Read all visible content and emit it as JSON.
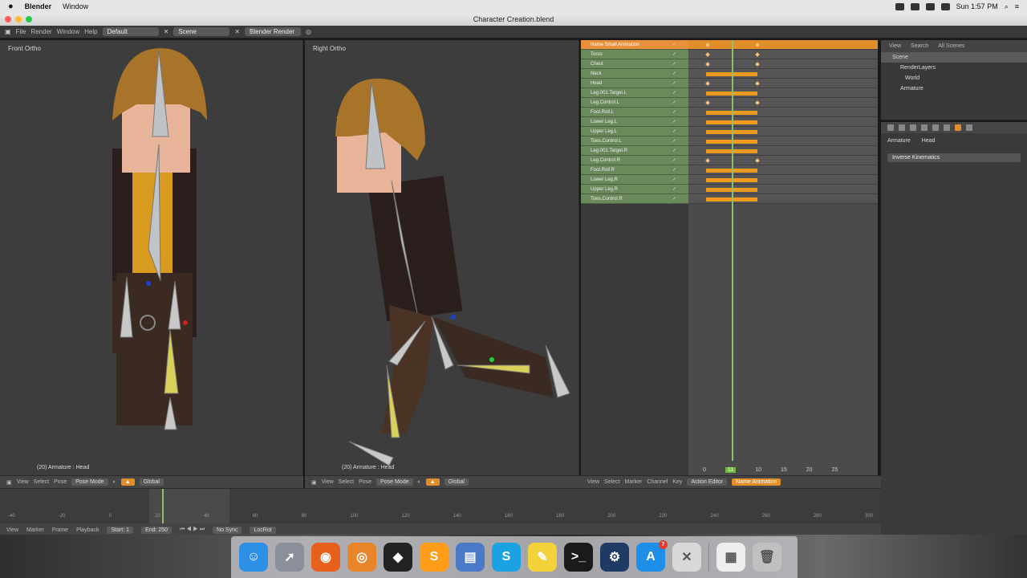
{
  "menubar": {
    "app": "Blender",
    "menu": "Window",
    "clock": "Sun 1:57 PM"
  },
  "window": {
    "title": "Character Creation.blend"
  },
  "info_header": {
    "menus": [
      "File",
      "Render",
      "Window",
      "Help"
    ],
    "layout": "Default",
    "scene": "Scene",
    "engine": "Blender Render"
  },
  "viewports": [
    {
      "label": "Front Ortho",
      "footer": "(20) Armature : Head"
    },
    {
      "label": "Right Ortho",
      "footer": "(20) Armature : Head"
    }
  ],
  "viewport_header": {
    "items": [
      "View",
      "Select",
      "Pose",
      "Pose Mode",
      "Global"
    ],
    "items_right": [
      "View",
      "Select",
      "Pose",
      "Pose Mode",
      "Global"
    ]
  },
  "dopesheet": {
    "channels": [
      "Name Small Animation",
      "Torso",
      "Chest",
      "Neck",
      "Head",
      "Leg.001.Target.L",
      "Leg.Control.L",
      "Foot.Roll.L",
      "Lower Leg.L",
      "Upper Leg.L",
      "Toes.Control.L",
      "Leg.001.Target.R",
      "Leg.Control.R",
      "Foot.Roll.R",
      "Lower Leg.R",
      "Upper Leg.R",
      "Toes.Control.R"
    ],
    "header": [
      "View",
      "Select",
      "Marker",
      "Channel",
      "Key",
      "Action Editor",
      "Name Animation"
    ],
    "frame_labels": [
      "0",
      "5",
      "10",
      "15",
      "20",
      "25"
    ],
    "current_frame": "11"
  },
  "outliner": {
    "tabs": [
      "View",
      "Search",
      "All Scenes"
    ],
    "items": [
      "Scene",
      "RenderLayers",
      "World",
      "Armature"
    ]
  },
  "properties": {
    "context": [
      "Armature",
      "Head"
    ],
    "field": "Inverse Kinematics"
  },
  "timeline": {
    "ruler": [
      "-40",
      "-20",
      "0",
      "20",
      "40",
      "60",
      "80",
      "100",
      "120",
      "140",
      "160",
      "180",
      "200",
      "220",
      "240",
      "260",
      "280",
      "300"
    ],
    "footer": [
      "View",
      "Marker",
      "Frame",
      "Playback",
      "Start: 1",
      "End: 250",
      "No Sync",
      "LocRot"
    ]
  },
  "dock": {
    "apps": [
      {
        "name": "finder",
        "glyph": "☺",
        "color": "#2e8fe6"
      },
      {
        "name": "launchpad",
        "glyph": "➚",
        "color": "#8a8f99"
      },
      {
        "name": "firefox",
        "glyph": "◉",
        "color": "#e8601e"
      },
      {
        "name": "blender",
        "glyph": "◎",
        "color": "#e8842a"
      },
      {
        "name": "unity",
        "glyph": "◆",
        "color": "#222222"
      },
      {
        "name": "sublime-text",
        "glyph": "S",
        "color": "#ff9c1a"
      },
      {
        "name": "video-editor",
        "glyph": "▤",
        "color": "#4a79c8"
      },
      {
        "name": "skype",
        "glyph": "S",
        "color": "#1aa3e0"
      },
      {
        "name": "notes",
        "glyph": "✎",
        "color": "#f4d23a"
      },
      {
        "name": "terminal",
        "glyph": ">_",
        "color": "#1a1a1a"
      },
      {
        "name": "steam",
        "glyph": "⚙",
        "color": "#1f3a64"
      },
      {
        "name": "app-store",
        "glyph": "A",
        "color": "#1e8fe8",
        "badge": "7"
      },
      {
        "name": "image-viewer",
        "glyph": "✕",
        "color": "#d8d8d8"
      },
      {
        "name": "document",
        "glyph": "▦",
        "color": "#eeeeee"
      },
      {
        "name": "trash",
        "glyph": "🗑",
        "color": "#c0c0c0"
      }
    ]
  }
}
